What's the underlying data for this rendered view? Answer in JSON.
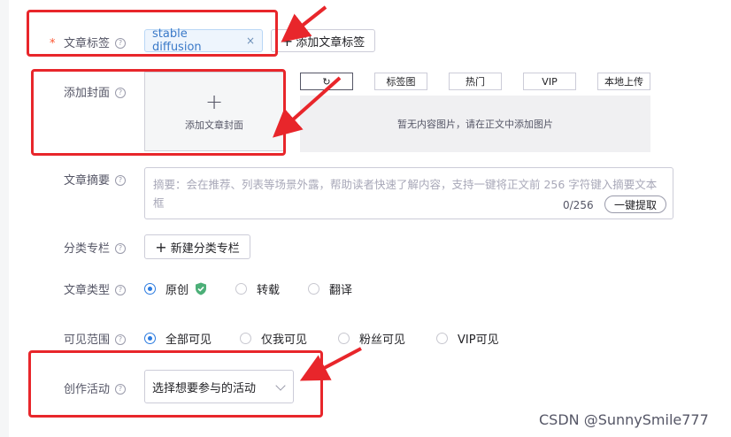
{
  "tags_row": {
    "required_mark": "*",
    "label": "文章标签",
    "help": "?",
    "tag_text": "stable diffusion",
    "tag_remove": "×",
    "add_label": "添加文章标签",
    "add_icon": "+"
  },
  "cover_row": {
    "label": "添加封面",
    "help": "?",
    "plus": "+",
    "add_label": "添加文章封面",
    "image_tabs": [
      "标签图",
      "热门",
      "VIP",
      "本地上传"
    ],
    "refresh_icon": "↻",
    "empty_text": "暂无内容图片，请在正文中添加图片"
  },
  "summary_row": {
    "label": "文章摘要",
    "help": "?",
    "placeholder": "摘要：会在推荐、列表等场景外露，帮助读者快速了解内容，支持一键将正文前 256 字符键入摘要文本框",
    "count": "0/256",
    "extract_button": "一键提取"
  },
  "column_row": {
    "label": "分类专栏",
    "help": "?",
    "new_icon": "+",
    "new_label": "新建分类专栏"
  },
  "type_row": {
    "label": "文章类型",
    "help": "?",
    "options": [
      "原创",
      "转载",
      "翻译"
    ],
    "selected": "原创",
    "verified_icon": "shield-check-icon"
  },
  "visibility_row": {
    "label": "可见范围",
    "help": "?",
    "options": [
      "全部可见",
      "仅我可见",
      "粉丝可见",
      "VIP可见"
    ],
    "selected": "全部可见"
  },
  "activity_row": {
    "label": "创作活动",
    "help": "?",
    "select_value": "选择想要参与的活动"
  },
  "watermark": "CSDN @SunnySmile777",
  "colors": {
    "accent": "#2b7be0",
    "annotation_red": "#e8262b",
    "required": "#fc5531",
    "verified_green": "#4caf78"
  }
}
